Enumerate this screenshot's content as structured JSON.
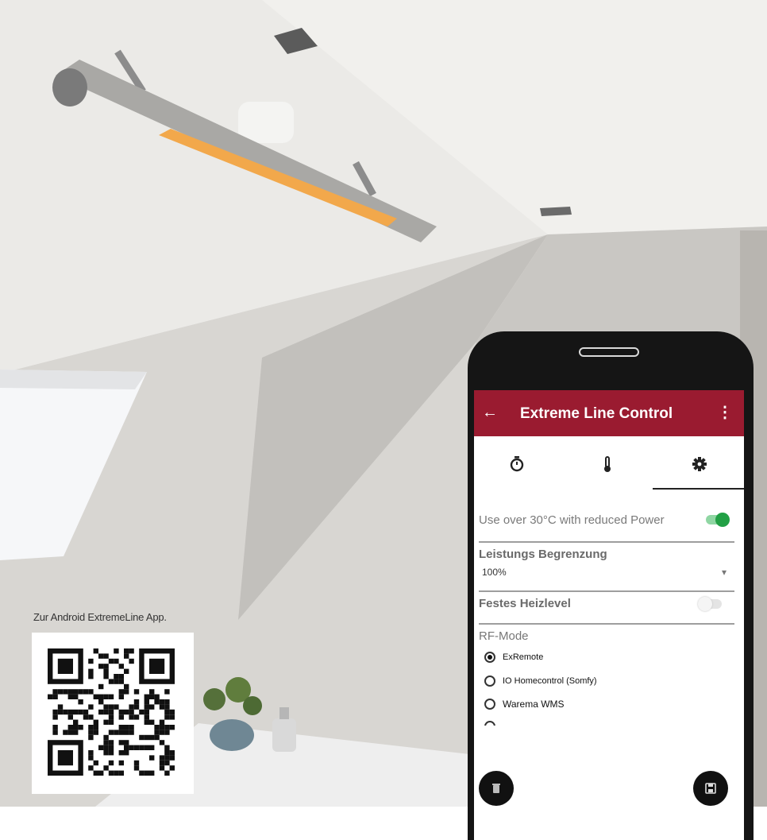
{
  "qr": {
    "caption": "Zur Android ExtremeLine App."
  },
  "app": {
    "title": "Extreme Line Control",
    "back_icon": "←",
    "menu_icon": "⋮",
    "accent_color": "#9a1b30",
    "toggle_on_color": "#22a045",
    "tabs": [
      {
        "icon": "timer-icon"
      },
      {
        "icon": "thermometer-icon"
      },
      {
        "icon": "gear-icon",
        "selected": true
      }
    ],
    "settings": {
      "reduced_power": {
        "label": "Use over 30°C with reduced Power",
        "enabled": true
      },
      "power_limit": {
        "label": "Leistungs Begrenzung",
        "value": "100%",
        "dropdown_icon": "▾"
      },
      "fixed_level": {
        "label": "Festes Heizlevel",
        "enabled": false
      },
      "rf_mode": {
        "label": "RF-Mode",
        "options": [
          {
            "label": "ExRemote",
            "checked": true
          },
          {
            "label": "IO Homecontrol (Somfy)",
            "checked": false
          },
          {
            "label": "Warema WMS",
            "checked": false
          }
        ]
      }
    }
  }
}
